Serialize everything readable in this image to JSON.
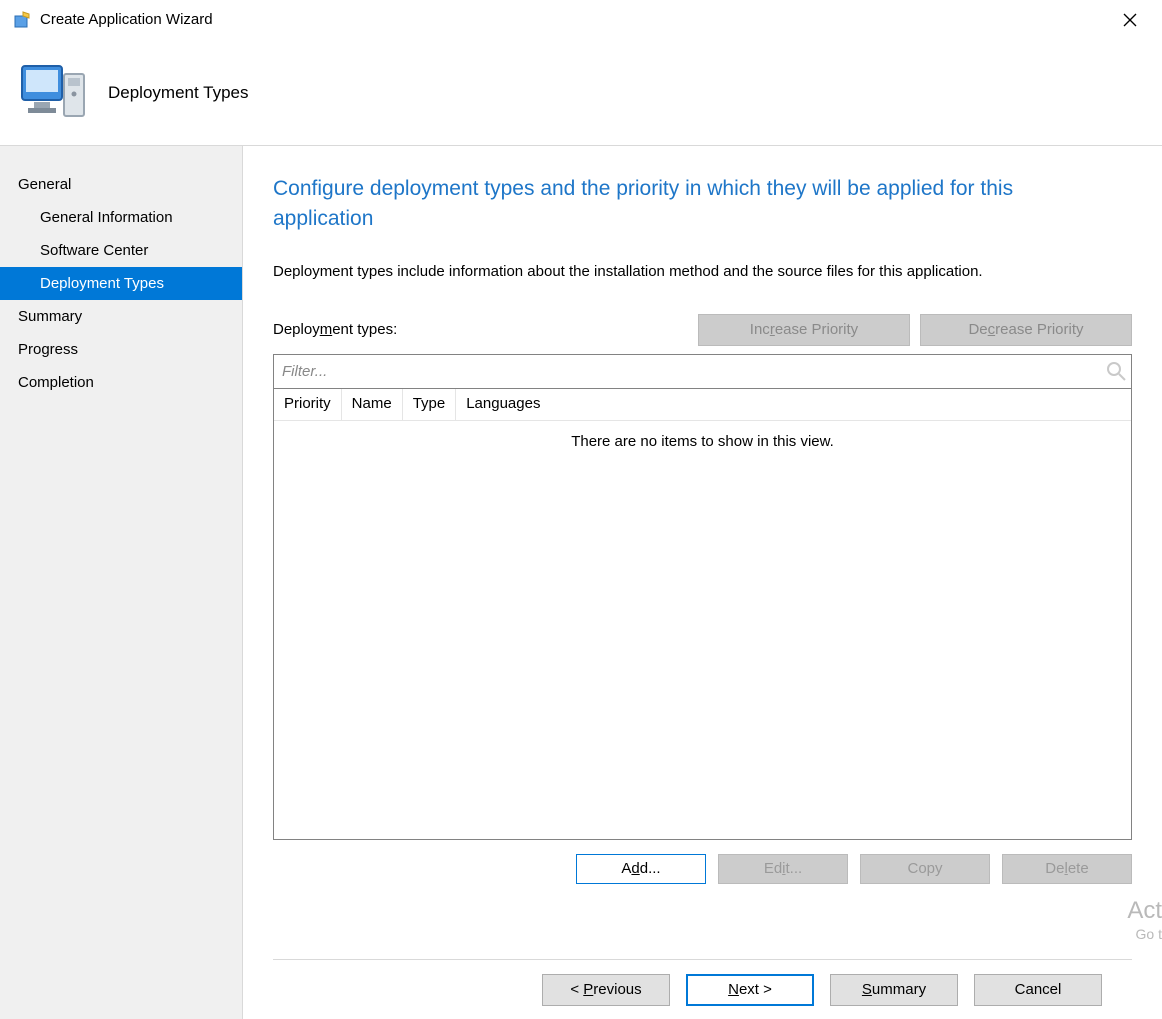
{
  "window": {
    "title": "Create Application Wizard"
  },
  "header": {
    "page_title": "Deployment Types"
  },
  "sidebar": {
    "items": [
      {
        "label": "General",
        "sub": false,
        "selected": false
      },
      {
        "label": "General Information",
        "sub": true,
        "selected": false
      },
      {
        "label": "Software Center",
        "sub": true,
        "selected": false
      },
      {
        "label": "Deployment Types",
        "sub": true,
        "selected": true
      },
      {
        "label": "Summary",
        "sub": false,
        "selected": false
      },
      {
        "label": "Progress",
        "sub": false,
        "selected": false
      },
      {
        "label": "Completion",
        "sub": false,
        "selected": false
      }
    ]
  },
  "main": {
    "headline": "Configure deployment types and the priority in which they will be applied for this application",
    "description": "Deployment types include information about the installation method and the source files for this application.",
    "dt_label_pre": "Deploy",
    "dt_label_key": "m",
    "dt_label_post": "ent types:",
    "increase_btn_pre": "Inc",
    "increase_btn_key": "r",
    "increase_btn_post": "ease Priority",
    "decrease_btn_pre": "De",
    "decrease_btn_key": "c",
    "decrease_btn_post": "rease Priority",
    "filter_placeholder": "Filter...",
    "columns": [
      "Priority",
      "Name",
      "Type",
      "Languages"
    ],
    "empty_text": "There are no items to show in this view.",
    "add_btn_pre": "A",
    "add_btn_key": "d",
    "add_btn_post": "d...",
    "edit_btn_pre": "Ed",
    "edit_btn_key": "i",
    "edit_btn_post": "t...",
    "copy_btn": "Copy",
    "delete_btn_pre": "De",
    "delete_btn_key": "l",
    "delete_btn_post": "ete"
  },
  "watermark": {
    "line1": "Act",
    "line2": "Go t"
  },
  "footer": {
    "prev_pre": "< ",
    "prev_key": "P",
    "prev_post": "revious",
    "next_key": "N",
    "next_post": "ext >",
    "summary_key": "S",
    "summary_post": "ummary",
    "cancel": "Cancel"
  }
}
